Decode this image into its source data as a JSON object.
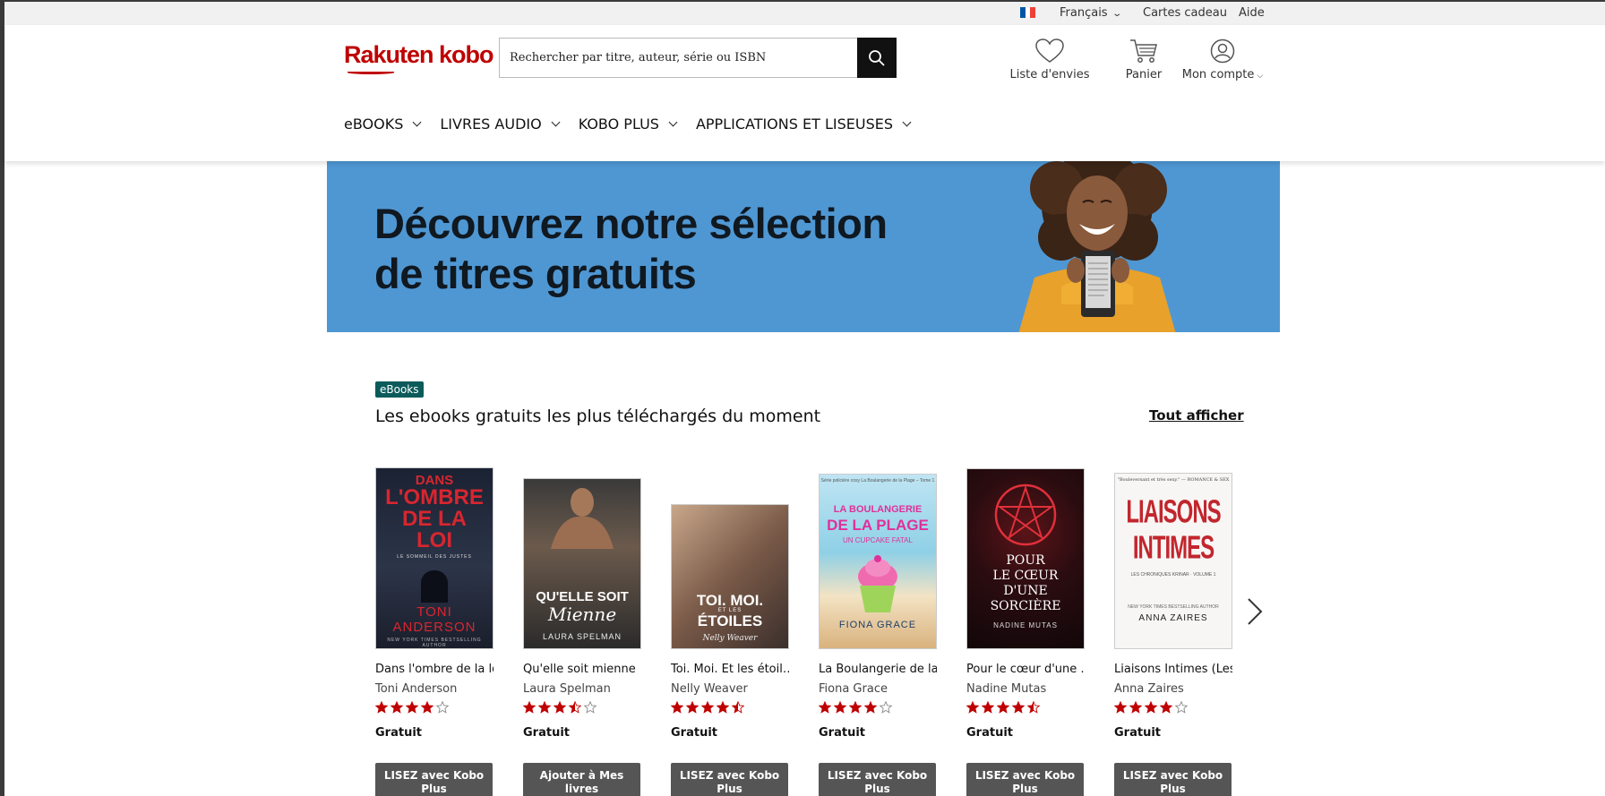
{
  "utility_bar": {
    "language": "Français",
    "gift_cards": "Cartes cadeau",
    "help": "Aide",
    "flag_colors": [
      "#0055a4",
      "#ffffff",
      "#ef4135"
    ]
  },
  "header": {
    "logo_text": "Rakuten kobo",
    "brand_color": "#bf0000",
    "search_placeholder": "Rechercher par titre, auteur, série ou ISBN",
    "search_icon": "search-icon",
    "wishlist_label": "Liste d'envies",
    "cart_label": "Panier",
    "account_label": "Mon compte"
  },
  "nav": {
    "items": [
      {
        "label": "eBOOKS"
      },
      {
        "label": "LIVRES AUDIO"
      },
      {
        "label": "KOBO PLUS"
      },
      {
        "label": "APPLICATIONS ET LISEUSES"
      }
    ]
  },
  "hero": {
    "line1": "Découvrez notre sélection",
    "line2": "de titres gratuits",
    "background_color": "#4f97d3"
  },
  "section": {
    "badge": "eBooks",
    "title": "Les ebooks gratuits les plus téléchargés du moment",
    "see_all": "Tout afficher"
  },
  "books": [
    {
      "title": "Dans l'ombre de la loi",
      "author": "Toni Anderson",
      "rating": 4,
      "price": "Gratuit",
      "cta": "LISEZ avec Kobo Plus",
      "cover_title": [
        "DANS",
        "L'OMBRE",
        "DE LA",
        "LOI"
      ],
      "cover_subtitle": "LE SOMMEIL DES JUSTES",
      "cover_author": [
        "TONI",
        "ANDERSON"
      ],
      "cover_tagline": "NEW YORK TIMES BESTSELLING AUTHOR"
    },
    {
      "title": "Qu'elle soit mienne",
      "author": "Laura Spelman",
      "rating": 3.5,
      "price": "Gratuit",
      "cta": "Ajouter à Mes livres",
      "cover_title": [
        "QU'ELLE SOIT",
        "Mienne"
      ],
      "cover_author": [
        "LAURA SPELMAN"
      ]
    },
    {
      "title": "Toi. Moi. Et les étoil…",
      "author": "Nelly Weaver",
      "rating": 4.5,
      "price": "Gratuit",
      "cta": "LISEZ avec Kobo Plus",
      "cover_title": [
        "TOI. MOI.",
        "ÉTOILES"
      ],
      "cover_subtitle": "ET LES",
      "cover_author": [
        "Nelly Weaver"
      ]
    },
    {
      "title": "La Boulangerie de la…",
      "author": "Fiona Grace",
      "rating": 4,
      "price": "Gratuit",
      "cta": "LISEZ avec Kobo Plus",
      "cover_tagline": "Série policière cosy La Boulangerie de la Plage – Tome 1",
      "cover_title": [
        "LA BOULANGERIE",
        "DE LA PLAGE"
      ],
      "cover_subtitle": "UN CUPCAKE FATAL",
      "cover_author": [
        "FIONA GRACE"
      ]
    },
    {
      "title": "Pour le cœur d'une …",
      "author": "Nadine Mutas",
      "rating": 4.5,
      "price": "Gratuit",
      "cta": "LISEZ avec Kobo Plus",
      "cover_title": [
        "POUR",
        "LE CŒUR",
        "D'UNE",
        "SORCIÈRE"
      ],
      "cover_author": [
        "NADINE MUTAS"
      ]
    },
    {
      "title": "Liaisons Intimes (Les…",
      "author": "Anna Zaires",
      "rating": 4,
      "price": "Gratuit",
      "cta": "LISEZ avec Kobo Plus",
      "cover_tagline": "\"Bouleversant et très sexy.\" — ROMANCE & SEX",
      "cover_title": [
        "LIAISONS",
        "INTIMES"
      ],
      "cover_subtitle": "LES CHRONIQUES KRINAR · VOLUME 1",
      "cover_author": [
        "ANNA ZAIRES"
      ],
      "cover_footer": "NEW YORK TIMES BESTSELLING AUTHOR"
    }
  ],
  "star_color": "#bf0000"
}
